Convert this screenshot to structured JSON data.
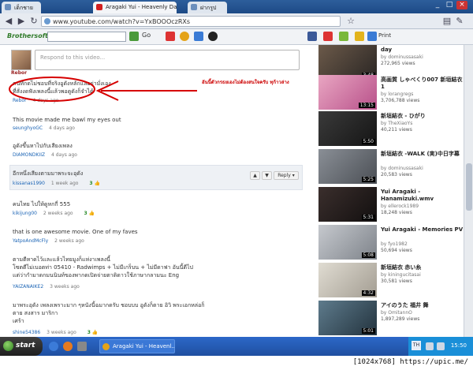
{
  "tabs": [
    {
      "label": "เด็กชาย",
      "active": false
    },
    {
      "label": "Aragaki Yui - Heavenly Days",
      "active": true
    },
    {
      "label": "ฝากรูป",
      "active": false
    }
  ],
  "addressbar": {
    "url": "www.youtube.com/watch?v=YxBOOOczRXs"
  },
  "toolbar": {
    "brand": "Brothersoft",
    "go_label": "Go",
    "print_label": "Print"
  },
  "comment_box": {
    "placeholder": "Respond to this video...",
    "avatar_name": "Rebor"
  },
  "annotation": {
    "text": "อันนี้ตัวกรธยเองไม่ต้องสนใจครับ ทุก้าวล่าง"
  },
  "comments": [
    {
      "lines": [
        "คนที่กดไม่ชอบที่จริงอูดังหลักแลอย่ามั่งเอง",
        "ที่สั่งงดฟังเพลงนี้แล้วพอดูดังก็จำได้"
      ],
      "user": "Rebor",
      "time": "4 days ago",
      "votes": ""
    },
    {
      "lines": [
        "This movie made me bawl my eyes out"
      ],
      "user": "seunghyoGC",
      "time": "4 days ago",
      "votes": ""
    },
    {
      "lines": [
        "อูดังขึ้นหาไปกับเสียงเพลง"
      ],
      "user": "DIAMONDKIIZ",
      "time": "4 days ago",
      "votes": ""
    },
    {
      "lines": [
        "อีกหนึ่งเสียงตามมาพระจะอุดัง"
      ],
      "user": "kissanas1990",
      "time": "1 week ago",
      "votes": "3"
    },
    {
      "lines": [
        "คนไทย ไปให้ดูหกกี่ 555"
      ],
      "user": "kikijung00",
      "time": "2 weeks ago",
      "votes": "3"
    },
    {
      "lines": [
        "that is one awesome movie. One of my faves"
      ],
      "user": "YatpoAndMcFly",
      "time": "2 weeks ago",
      "votes": ""
    },
    {
      "lines": [
        "ตามตีหาดไว้และแล้วไทยมูงก็แห่งาเพลงนี้",
        "โซตตีไม่เบอตท่า 05410 - Radwimps + ไม่มีเกร็บน + ไม่มีดาฟา อันนี้ดีไป",
        "แต่ว่ากำมาดกมนนินท์ของพากดเปิดจ่ายตาดิดาวใช้ภาษากลามนะ Eng"
      ],
      "user": "YAIZANAIKE2",
      "time": "3 weeks ago",
      "votes": ""
    },
    {
      "lines": [
        "มาพระอุดัง เพลงเพราะมาก ๆหนังนี้ฉมากดรับ ชอบบบ อูดังก็ตาย อิวิ พระเอกหล่อก็",
        "ตาย สงสาร มาริกา",
        "เศร้า"
      ],
      "user": "shine54386",
      "time": "3 weeks ago",
      "votes": "3"
    }
  ],
  "reply_button": "Reply",
  "sidebar": [
    {
      "title": "day",
      "by": "by dominussasaki",
      "views": "272,965 views",
      "duration": "3:48"
    },
    {
      "title": "高画質 しゃべくり007 新垣結衣 1",
      "by": "by lorangregs",
      "views": "3,706,788 views",
      "duration": "13:15"
    },
    {
      "title": "新垣結衣 - ひがり",
      "by": "by TheXiaoYs",
      "views": "40,211 views",
      "duration": "5:50"
    },
    {
      "title": "新垣結衣 -WALK (実)中日字幕",
      "by": "by dominussasaki",
      "views": "20,583 views",
      "duration": "5:25"
    },
    {
      "title": "Yui Aragaki - Hanamizuki.wmv",
      "by": "by ellerock1989",
      "views": "18,248 views",
      "duration": "5:31"
    },
    {
      "title": "Yui Aragaki - Memories PV",
      "by": "by fyo1982",
      "views": "50,694 views",
      "duration": "5:08"
    },
    {
      "title": "新垣結衣 赤い糸",
      "by": "by kiningucitasai",
      "views": "30,581 views",
      "duration": "4:32"
    },
    {
      "title": "アイのうた 福井 舞",
      "by": "by OmitannO",
      "views": "1,897,289 views",
      "duration": "5:01"
    }
  ],
  "taskbar": {
    "start_label": "start",
    "task_label": "Aragaki Yui - Heavenl...",
    "lang": "TH",
    "clock": "15:50"
  },
  "resolution_banner": "[1024x768] https://upic.me/"
}
